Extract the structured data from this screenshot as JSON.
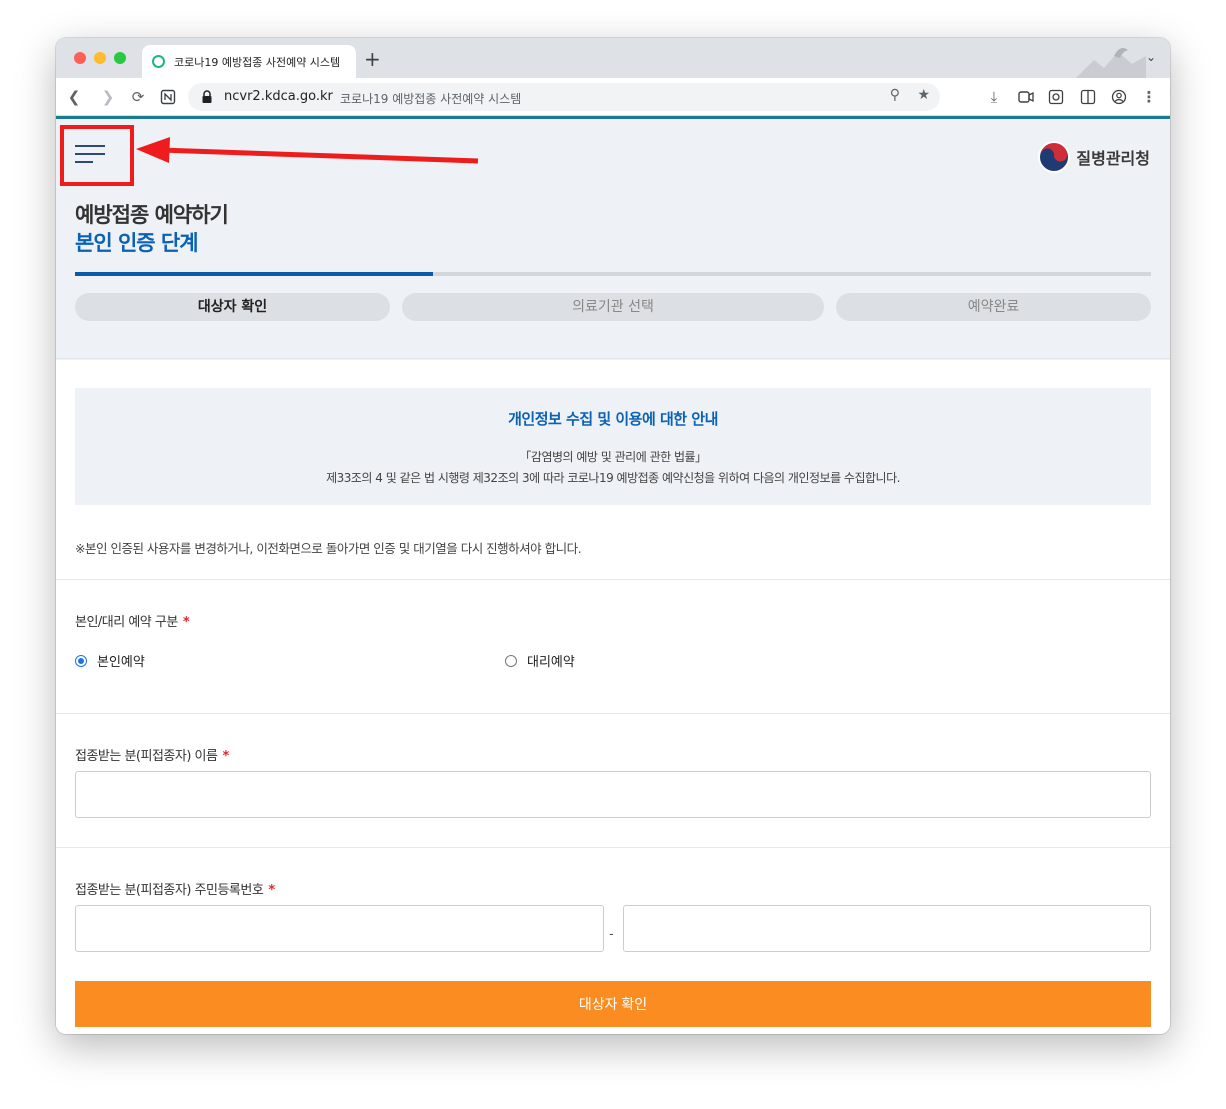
{
  "browser": {
    "tab_title": "코로나19 예방접종 사전예약 시스템",
    "new_tab": "+",
    "url_host": "ncvr2.kdca.go.kr",
    "url_page_title": "코로나19 예방접종 사전예약 시스템"
  },
  "header": {
    "agency_name": "질병관리청",
    "title": "예방접종 예약하기",
    "subtitle": "본인 인증 단계",
    "progress_fraction": 0.333
  },
  "steps": [
    {
      "label": "대상자 확인",
      "active": true
    },
    {
      "label": "의료기관 선택",
      "active": false
    },
    {
      "label": "예약완료",
      "active": false
    }
  ],
  "notice": {
    "title": "개인정보 수집 및 이용에 대한 안내",
    "line1": "「감염병의 예방 및 관리에 관한 법률」",
    "line2": "제33조의 4 및 같은 법 시행령 제32조의 3에 따라 코로나19 예방접종 예약신청을 위하여 다음의 개인정보를 수집합니다."
  },
  "warning": "※본인 인증된 사용자를 변경하거나, 이전화면으로 돌아가면 인증 및 대기열을 다시 진행하셔야 합니다.",
  "form": {
    "type_label": "본인/대리 예약 구분",
    "required_mark": "*",
    "option_self": "본인예약",
    "option_proxy": "대리예약",
    "name_label": "접종받는 분(피접종자) 이름",
    "rrn_label": "접종받는 분(피접종자) 주민등록번호",
    "rrn_separator": "-",
    "submit_label": "대상자 확인"
  },
  "colors": {
    "brand_blue": "#0b62b5",
    "accent_orange": "#fb8c21",
    "annotation_red": "#ee1c1c"
  }
}
